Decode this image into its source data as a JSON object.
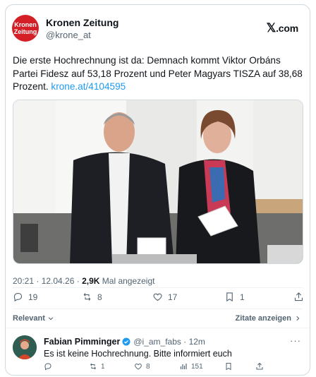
{
  "author": {
    "logo_line1": "Kronen",
    "logo_line2": "Zeitung",
    "name": "Kronen Zeitung",
    "handle": "@krone_at"
  },
  "brand": {
    "x": "𝕏",
    "label": ".com"
  },
  "tweet": {
    "text": "Die erste Hochrechnung ist da: Demnach kommt Viktor Orbáns Partei Fidesz auf 53,18 Prozent und Peter Magyars TISZA auf 38,68 Prozent. ",
    "link": "krone.at/4104595"
  },
  "meta": {
    "time": "20:21 · 12.04.26 · ",
    "views": "2,9K",
    "views_label": " Mal angezeigt"
  },
  "actions": {
    "replies": "19",
    "reposts": "8",
    "likes": "17",
    "bookmarks": "1"
  },
  "sort": {
    "relevant": "Relevant",
    "quotes": "Zitate anzeigen"
  },
  "reply": {
    "name": "Fabian Pimminger",
    "handle": "@i_am_fabs · 12m",
    "text": "Es ist keine Hochrechnung. Bitte informiert euch",
    "more": "···",
    "replies": "",
    "reposts": "1",
    "likes": "8",
    "views": "151"
  },
  "colors": {
    "accent": "#1d9bf0",
    "kronen_red": "#d41f26",
    "muted": "#536471"
  }
}
